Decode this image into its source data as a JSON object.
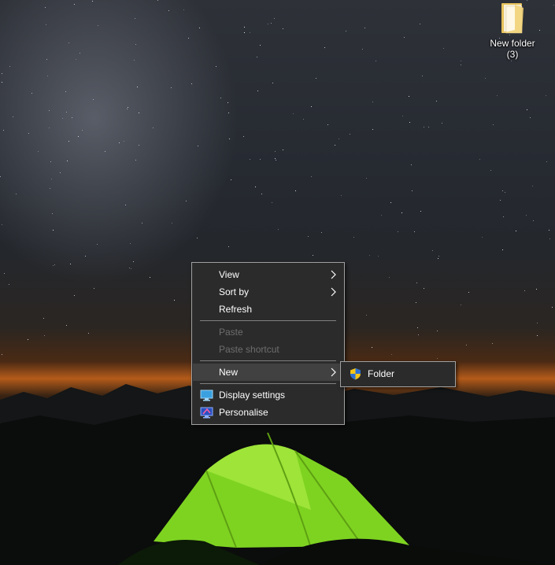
{
  "desktop": {
    "icons": [
      {
        "label": "New folder\n(3)",
        "icon": "folder-icon"
      }
    ]
  },
  "context_menu": {
    "items": [
      {
        "label": "View",
        "has_submenu": true,
        "enabled": true
      },
      {
        "label": "Sort by",
        "has_submenu": true,
        "enabled": true
      },
      {
        "label": "Refresh",
        "has_submenu": false,
        "enabled": true
      },
      {
        "label": "Paste",
        "has_submenu": false,
        "enabled": false
      },
      {
        "label": "Paste shortcut",
        "has_submenu": false,
        "enabled": false
      },
      {
        "label": "New",
        "has_submenu": true,
        "enabled": true,
        "highlighted": true
      },
      {
        "label": "Display settings",
        "icon": "display-icon",
        "enabled": true
      },
      {
        "label": "Personalise",
        "icon": "personalise-icon",
        "enabled": true
      }
    ]
  },
  "submenu": {
    "items": [
      {
        "label": "Folder",
        "icon": "shield-icon"
      }
    ]
  },
  "colors": {
    "menu_background": "#2b2b2b",
    "menu_border": "#a0a0a0",
    "menu_highlight": "#414141",
    "disabled_text": "#6d6d6d",
    "tent_green": "#7ed321"
  }
}
